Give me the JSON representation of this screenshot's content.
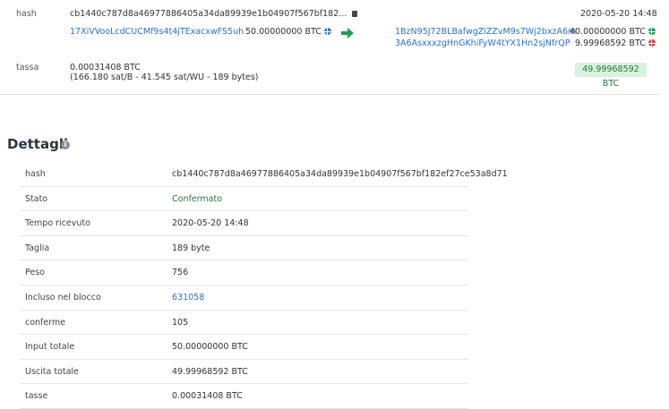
{
  "tx": {
    "hash_label": "hash",
    "hash_short": "cb1440c787d8a46977886405a34da89939e1b04907f567bf182...",
    "time": "2020-05-20 14:48",
    "input_address": "17XiVVooLcdCUCMf9s4t4jTExacxwFS5uh",
    "input_amount": "50.00000000 BTC",
    "outputs": [
      {
        "address": "1BzN95J72BLBafwgZiZZvM9s7Wj2bxzA6m",
        "amount": "40.00000000 BTC",
        "status_icon": "green-globe"
      },
      {
        "address": "3A6AsxxxzgHnGKhiFyW4tYX1Hn2sjNfrQP",
        "amount": "9.99968592 BTC",
        "status_icon": "red-globe"
      }
    ],
    "fee_label": "tassa",
    "fee_amount": "0.00031408 BTC",
    "fee_detail": "(166.180 sat/B - 41.545 sat/WU - 189 bytes)",
    "total_out": "49.99968592 BTC"
  },
  "details": {
    "title": "Dettagli",
    "rows": [
      {
        "key": "hash",
        "value": "cb1440c787d8a46977886405a34da89939e1b04907f567bf182ef27ce53a8d71"
      },
      {
        "key": "Stato",
        "value": "Confermato"
      },
      {
        "key": "Tempo ricevuto",
        "value": "2020-05-20 14:48"
      },
      {
        "key": "Taglia",
        "value": "189 byte"
      },
      {
        "key": "Peso",
        "value": "756"
      },
      {
        "key": "Incluso nel blocco",
        "value": "631058"
      },
      {
        "key": "conferme",
        "value": "105"
      },
      {
        "key": "Input totale",
        "value": "50.00000000 BTC"
      },
      {
        "key": "Uscita totale",
        "value": "49.99968592 BTC"
      },
      {
        "key": "tasse",
        "value": "0.00031408 BTC"
      }
    ]
  },
  "colors": {
    "link": "#2a6fdb",
    "confirmed": "#237a3b",
    "badge_bg": "#d9f2de"
  }
}
